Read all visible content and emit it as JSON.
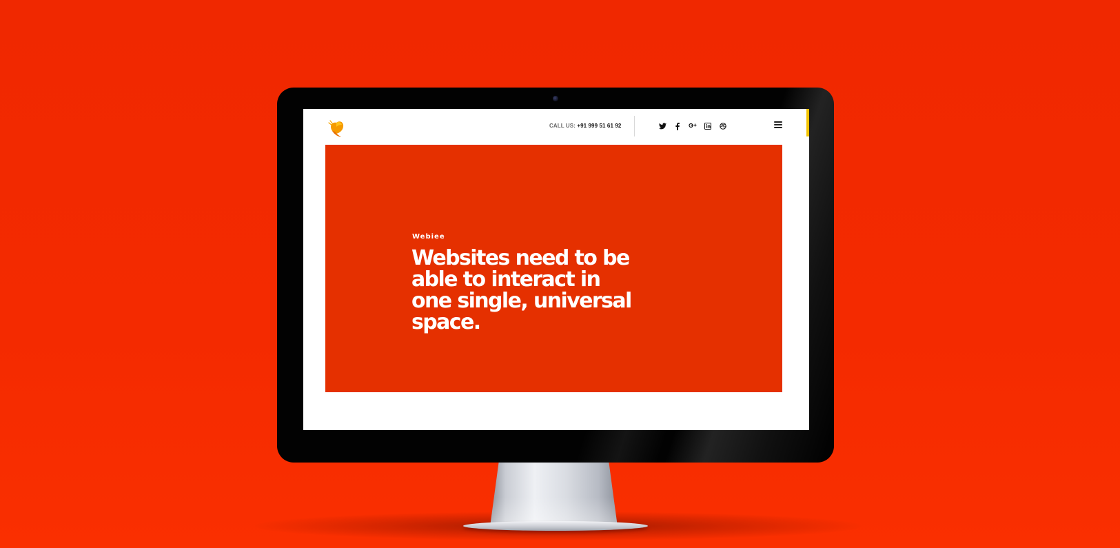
{
  "header": {
    "call_label": "CALL US:",
    "call_number": "+91 999 51 61 92",
    "social_icons": [
      "twitter-icon",
      "facebook-icon",
      "google-plus-icon",
      "linkedin-icon",
      "dribbble-icon"
    ],
    "menu_icon": "hamburger-menu-icon"
  },
  "hero": {
    "eyebrow": "Webiee",
    "headline": "Websites need to be able to interact in one single, universal space."
  },
  "colors": {
    "background": "#f42a00",
    "hero": "#e53000",
    "accent": "#f3c300",
    "logo": "#f59a00"
  }
}
